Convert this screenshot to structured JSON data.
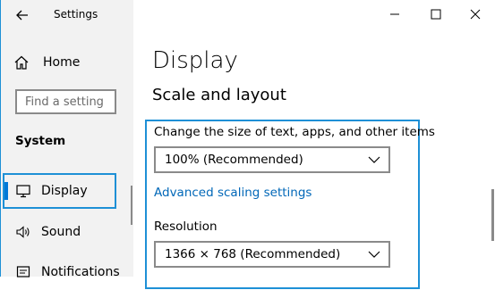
{
  "window": {
    "title": "Settings"
  },
  "sidebar": {
    "home_label": "Home",
    "search_placeholder": "Find a setting",
    "section_title": "System",
    "items": [
      {
        "label": "Display",
        "icon": "monitor-icon",
        "selected": true
      },
      {
        "label": "Sound",
        "icon": "speaker-icon",
        "selected": false
      },
      {
        "label": "Notifications",
        "icon": "notifications-icon",
        "selected": false
      }
    ]
  },
  "main": {
    "page_title": "Display",
    "section_title": "Scale and layout",
    "scale_label": "Change the size of text, apps, and other items",
    "scale_value": "100% (Recommended)",
    "advanced_link": "Advanced scaling settings",
    "resolution_label": "Resolution",
    "resolution_value": "1366 × 768 (Recommended)"
  },
  "colors": {
    "highlight_border": "#1e90d6",
    "link": "#0067b8",
    "accent": "#0078d7",
    "sidebar_bg": "#f2f2f2"
  }
}
